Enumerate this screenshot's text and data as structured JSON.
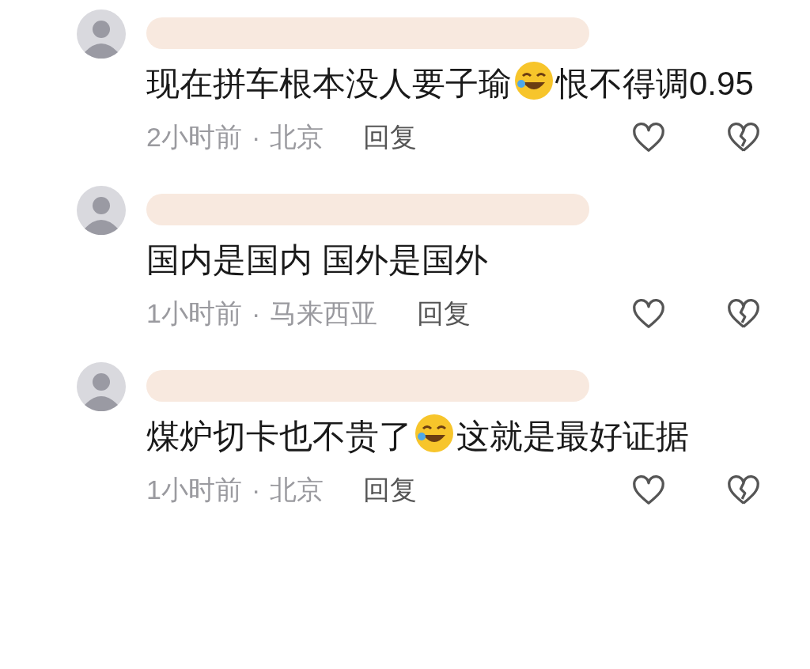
{
  "comments": [
    {
      "segments": [
        {
          "kind": "text",
          "text": "现在拼车根本没人要子瑜"
        },
        {
          "kind": "emoji"
        },
        {
          "kind": "text",
          "text": "恨不得调0.95"
        }
      ],
      "time": "2小时前",
      "location": "北京",
      "reply": "回复"
    },
    {
      "segments": [
        {
          "kind": "text",
          "text": "国内是国内 国外是国外"
        }
      ],
      "time": "1小时前",
      "location": "马来西亚",
      "reply": "回复"
    },
    {
      "segments": [
        {
          "kind": "text",
          "text": "煤炉切卡也不贵了"
        },
        {
          "kind": "emoji"
        },
        {
          "kind": "text",
          "text": "这就是最好证据"
        }
      ],
      "time": "1小时前",
      "location": "北京",
      "reply": "回复"
    }
  ],
  "separator": "·"
}
